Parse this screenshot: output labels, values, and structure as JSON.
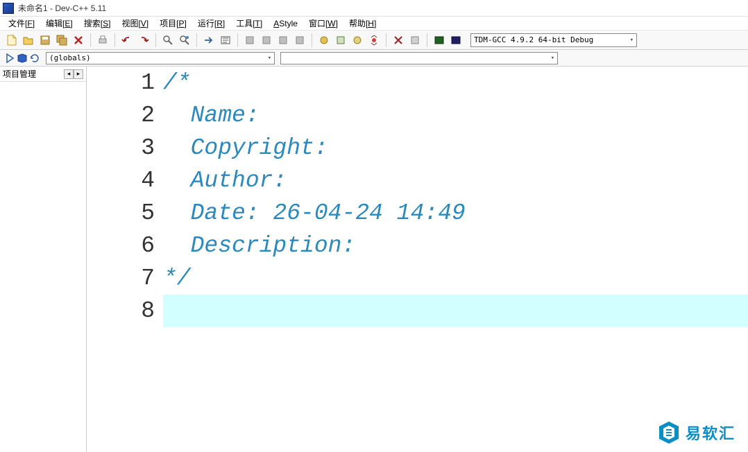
{
  "title": "未命名1 - Dev-C++ 5.11",
  "menu": {
    "file": {
      "label": "文件[",
      "accel": "F",
      "suffix": "]"
    },
    "edit": {
      "label": "编辑[",
      "accel": "E",
      "suffix": "]"
    },
    "search": {
      "label": "搜索[",
      "accel": "S",
      "suffix": "]"
    },
    "view": {
      "label": "视图[",
      "accel": "V",
      "suffix": "]"
    },
    "project": {
      "label": "项目[",
      "accel": "P",
      "suffix": "]"
    },
    "run": {
      "label": "运行[",
      "accel": "R",
      "suffix": "]"
    },
    "tools": {
      "label": "工具[",
      "accel": "T",
      "suffix": "]"
    },
    "astyle": {
      "label": "AStyle"
    },
    "window": {
      "label": "窗口[",
      "accel": "W",
      "suffix": "]"
    },
    "help": {
      "label": "帮助[",
      "accel": "H",
      "suffix": "]"
    }
  },
  "toolbar": {
    "compiler": "TDM-GCC 4.9.2 64-bit Debug"
  },
  "globals_combo": "(globals)",
  "sidebar": {
    "project_mgmt": "项目管理"
  },
  "editor": {
    "line_numbers": [
      "1",
      "2",
      "3",
      "4",
      "5",
      "6",
      "7",
      "8"
    ],
    "lines": [
      "/*",
      "  Name:",
      "  Copyright:",
      "  Author:",
      "  Date: 26-04-24 14:49",
      "  Description:",
      "*/",
      ""
    ]
  },
  "watermark": "易软汇"
}
